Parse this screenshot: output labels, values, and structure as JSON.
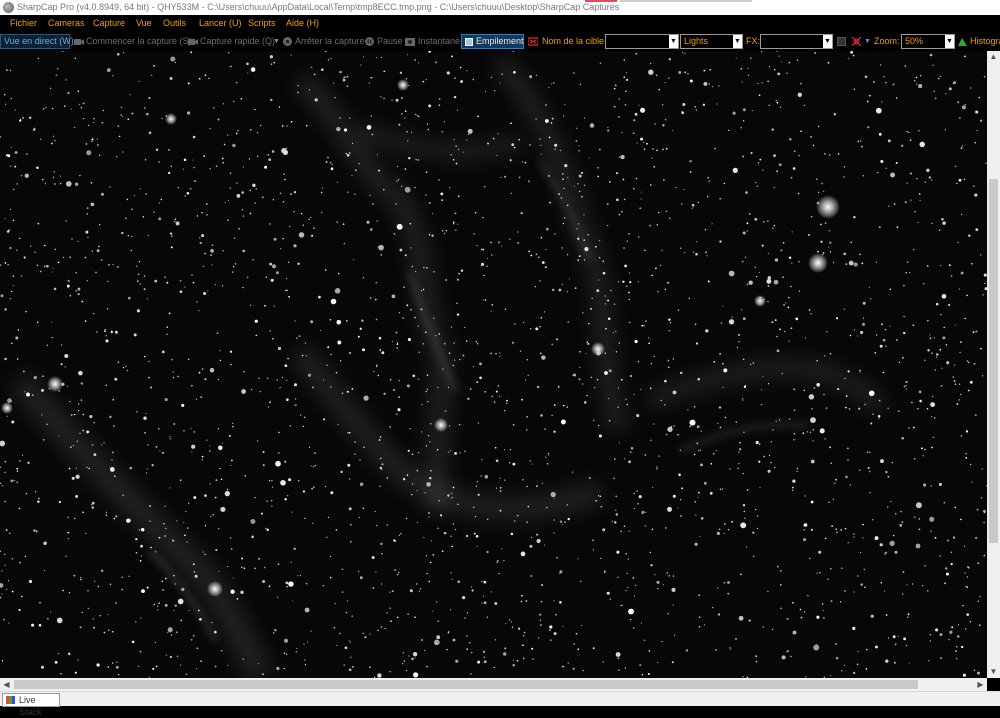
{
  "window": {
    "title": "SharpCap Pro (v4.0.8949, 64 bit) - QHY533M - C:\\Users\\chuuu\\AppData\\Local\\Temp\\tmp8ECC.tmp.png - C:\\Users\\chuuu\\Desktop\\SharpCap Captures"
  },
  "menu": {
    "items": [
      "Fichier",
      "Cameras",
      "Capture",
      "Vue",
      "Outils",
      "Lancer (U)",
      "Scripts",
      "Aide (H)"
    ]
  },
  "toolbar": {
    "live_view": "Vue en direct (W)",
    "start_capture": "Commencer la capture (S)",
    "quick_capture": "Capture rapide (Q)",
    "stop_capture": "Arrêter la capture",
    "pause": "Pause",
    "snapshot": "Instantané",
    "stacking": "Empilement",
    "target_label": "Nom de la cible:",
    "target_value": "",
    "frame_type": "Lights",
    "fx_label": "FX:",
    "fx_value": "",
    "zoom_label": "Zoom:",
    "zoom_value": "50%",
    "histogram": "Histogra"
  },
  "statusbar": {
    "live_stack_tab": "Live Stack"
  },
  "colors": {
    "accent": "#f0a000",
    "background": "#000000",
    "active_button": "#2a7fc0"
  }
}
